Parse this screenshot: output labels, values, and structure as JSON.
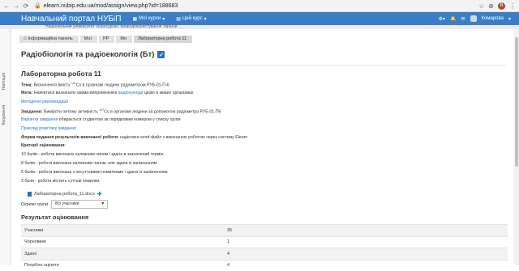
{
  "browser": {
    "back": "←",
    "forward": "→",
    "reload": "⟳",
    "url": "elearn.nubip.edu.ua/mod/assign/view.php?id=188683",
    "avatar_letter": "B"
  },
  "topnav": {
    "brand": "Навчальний портал НУБіП",
    "menu1": "Мої курси",
    "menu2": "Цей курс",
    "user": "Комарова"
  },
  "subheader": "Національний університет біоресурсів і природокористування України",
  "drawer": {
    "tab1": "Навігація",
    "tab2": "Керування"
  },
  "breadcrumbs": [
    "Інформаційна панель",
    "Мої",
    "РР",
    "Мо",
    "Лабораторна робота 11"
  ],
  "course_title": "Радіобіологія та радіоекологія (Бт)",
  "lab_title": "Лабораторна робота 11",
  "lines": {
    "tema_label": "Тема:",
    "tema_text": "Визначення вмісту ",
    "tema_sup": "137",
    "tema_text2": "Cs в організмі людини радіометром РУБ-01-П-6",
    "meta_label": "Мета:",
    "meta_text": "Навчитися визначати гамма-випромінюючі ",
    "meta_link": "радіонукліди",
    "meta_text2": " цезію в живих організмах",
    "method_link": "Методичні рекомендації",
    "zav_label": "Завдання:",
    "zav_text": "Виміряти питому активність ",
    "zav_sup": "137",
    "zav_text2": "Cs в організмі людини за допомогою радіометра РУБ-01-П6",
    "variant_link": "Варіанти завдання",
    "variant_text": " обирається студентом за порядковим номером у списку групи",
    "example_link": "Приклад розв'язку завдання",
    "form_label": "Форма подання результатів виконаної роботи:",
    "form_text": " надіслати word-файл з виконаною роботою через систему Elearn",
    "crit_label": "Критерії оцінювання:",
    "crit1": "10 балів - робота виконана належним чином і здана в зазначений термін.",
    "crit2": "8 балів - робота виконана належним чином, але здана із запізненням.",
    "crit3": "5 балів - робота виконана з несуттєвими помилками і здана із запізненням.",
    "crit4": "3 бали - робота містить суттєві помилки."
  },
  "file_name": "Лабораторна робота_11.docx",
  "groups": {
    "label": "Окремі групи",
    "selected": "Всі учасники"
  },
  "results_title": "Результат оцінювання",
  "grading": [
    {
      "label": "Учасники",
      "value": "35"
    },
    {
      "label": "Чорновики",
      "value": "1"
    },
    {
      "label": "Здано",
      "value": "4"
    },
    {
      "label": "Потрібно оцінити",
      "value": "4"
    }
  ],
  "colors": {
    "accent": "#3b7ec7",
    "link": "#2a6fc9"
  }
}
